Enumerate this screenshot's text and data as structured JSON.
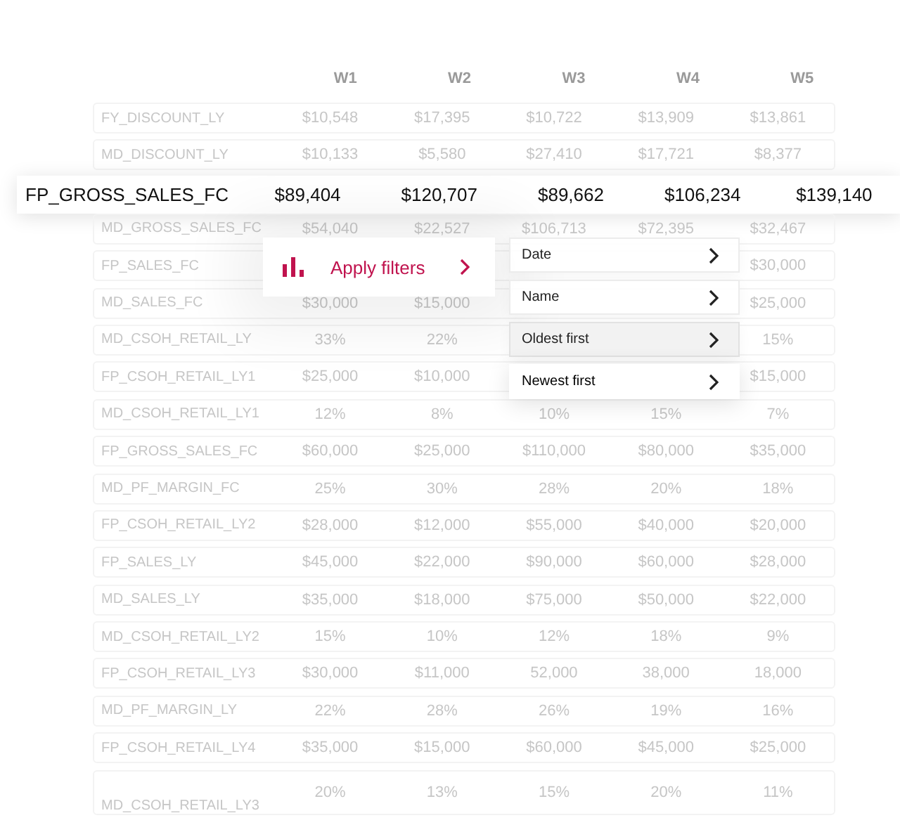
{
  "table": {
    "columns": [
      "W1",
      "W2",
      "W3",
      "W4",
      "W5"
    ],
    "rows": [
      {
        "label": "FY_DISCOUNT_LY",
        "cells": [
          "$10,548",
          "$17,395",
          "$10,722",
          "$13,909",
          "$13,861"
        ]
      },
      {
        "label": "MD_DISCOUNT_LY",
        "cells": [
          "$10,133",
          "$5,580",
          "$27,410",
          "$17,721",
          "$8,377"
        ]
      },
      {
        "label": "FP_GROSS_SALES_FC",
        "cells": [
          "$89,404",
          "$120,707",
          "$89,662",
          "$106,234",
          "$139,140"
        ],
        "highlighted": true
      },
      {
        "label": "MD_GROSS_SALES_FC",
        "cells": [
          "$54,040",
          "$22,527",
          "$106,713",
          "$72,395",
          "$32,467"
        ]
      },
      {
        "label": "FP_SALES_FC",
        "cells": [
          null,
          null,
          null,
          null,
          "$30,000"
        ]
      },
      {
        "label": "MD_SALES_FC",
        "cells": [
          "$30,000",
          "$15,000",
          null,
          null,
          "$25,000"
        ]
      },
      {
        "label": "MD_CSOH_RETAIL_LY",
        "cells": [
          "33%",
          "22%",
          null,
          null,
          "15%"
        ]
      },
      {
        "label": "FP_CSOH_RETAIL_LY1",
        "cells": [
          "$25,000",
          "$10,000",
          null,
          null,
          "$15,000"
        ]
      },
      {
        "label": "MD_CSOH_RETAIL_LY1",
        "cells": [
          "12%",
          "8%",
          "10%",
          "15%",
          "7%"
        ]
      },
      {
        "label": "FP_GROSS_SALES_FC",
        "cells": [
          "$60,000",
          "$25,000",
          "$110,000",
          "$80,000",
          "$35,000"
        ]
      },
      {
        "label": "MD_PF_MARGIN_FC",
        "cells": [
          "25%",
          "30%",
          "28%",
          "20%",
          "18%"
        ]
      },
      {
        "label": "FP_CSOH_RETAIL_LY2",
        "cells": [
          "$28,000",
          "$12,000",
          "$55,000",
          "$40,000",
          "$20,000"
        ]
      },
      {
        "label": "FP_SALES_LY",
        "cells": [
          "$45,000",
          "$22,000",
          "$90,000",
          "$60,000",
          "$28,000"
        ]
      },
      {
        "label": "MD_SALES_LY",
        "cells": [
          "$35,000",
          "$18,000",
          "$75,000",
          "$50,000",
          "$22,000"
        ]
      },
      {
        "label": "MD_CSOH_RETAIL_LY2",
        "cells": [
          "15%",
          "10%",
          "12%",
          "18%",
          "9%"
        ]
      },
      {
        "label": "FP_CSOH_RETAIL_LY3",
        "cells": [
          "$30,000",
          "$11,000",
          "52,000",
          "38,000",
          "18,000"
        ]
      },
      {
        "label": "MD_PF_MARGIN_LY",
        "cells": [
          "22%",
          "28%",
          "26%",
          "19%",
          "16%"
        ]
      },
      {
        "label": "FP_CSOH_RETAIL_LY4",
        "cells": [
          "$35,000",
          "$15,000",
          "$60,000",
          "$45,000",
          "$25,000"
        ]
      },
      {
        "label": "MD_CSOH_RETAIL_LY3",
        "cells": [
          "20%",
          "13%",
          "15%",
          "20%",
          "11%"
        ],
        "tall": true
      }
    ]
  },
  "filter_button": {
    "label": "Apply filters"
  },
  "sort_menu": [
    {
      "label": "Date",
      "selected": false
    },
    {
      "label": "Name",
      "selected": false
    },
    {
      "label": "Oldest first",
      "selected": false,
      "hovered": true
    },
    {
      "label": "Newest first",
      "selected": true
    }
  ]
}
